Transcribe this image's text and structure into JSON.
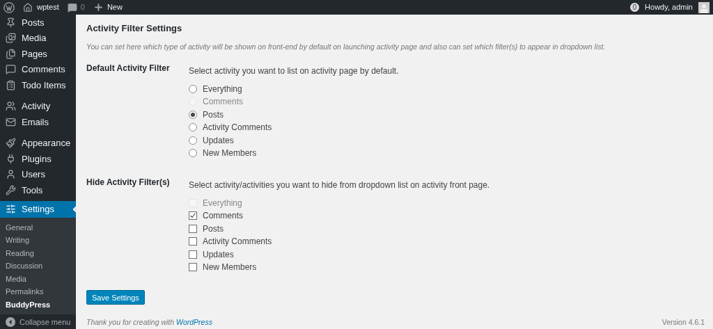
{
  "admin_bar": {
    "site": "wptest",
    "comments": "0",
    "new": "New",
    "notifications": "0",
    "greeting": "Howdy, admin"
  },
  "sidebar": {
    "groups": [
      [
        {
          "label": "Posts",
          "selected": false
        },
        {
          "label": "Media",
          "selected": false
        },
        {
          "label": "Pages",
          "selected": false
        },
        {
          "label": "Comments",
          "selected": false
        },
        {
          "label": "Todo Items",
          "selected": false
        }
      ],
      [
        {
          "label": "Activity",
          "selected": false
        },
        {
          "label": "Emails",
          "selected": false
        }
      ],
      [
        {
          "label": "Appearance",
          "selected": false
        },
        {
          "label": "Plugins",
          "selected": false
        },
        {
          "label": "Users",
          "selected": false
        },
        {
          "label": "Tools",
          "selected": false
        },
        {
          "label": "Settings",
          "selected": true
        }
      ]
    ],
    "submenu": [
      {
        "label": "General",
        "selected": false
      },
      {
        "label": "Writing",
        "selected": false
      },
      {
        "label": "Reading",
        "selected": false
      },
      {
        "label": "Discussion",
        "selected": false
      },
      {
        "label": "Media",
        "selected": false
      },
      {
        "label": "Permalinks",
        "selected": false
      },
      {
        "label": "BuddyPress",
        "selected": true
      }
    ],
    "collapse": "Collapse menu"
  },
  "page": {
    "title": "Activity Filter Settings",
    "description": "You can set here which type of activity will be shown on front-end by default on launching activity page and also can set which filter(s) to appear in dropdown list.",
    "sections": [
      {
        "label": "Default Activity Filter",
        "instruction": "Select activity you want to list on activity page by default.",
        "kind": "radio",
        "options": [
          {
            "label": "Everything",
            "selected": false,
            "disabled": false
          },
          {
            "label": "Comments",
            "selected": false,
            "disabled": true
          },
          {
            "label": "Posts",
            "selected": true,
            "disabled": false
          },
          {
            "label": "Activity Comments",
            "selected": false,
            "disabled": false
          },
          {
            "label": "Updates",
            "selected": false,
            "disabled": false
          },
          {
            "label": "New Members",
            "selected": false,
            "disabled": false
          }
        ]
      },
      {
        "label": "Hide Activity Filter(s)",
        "instruction": "Select activity/activities you want to hide from dropdown list on activity front page.",
        "kind": "checkbox",
        "options": [
          {
            "label": "Everything",
            "checked": false,
            "disabled": true
          },
          {
            "label": "Comments",
            "checked": true,
            "disabled": false
          },
          {
            "label": "Posts",
            "checked": false,
            "disabled": false
          },
          {
            "label": "Activity Comments",
            "checked": false,
            "disabled": false
          },
          {
            "label": "Updates",
            "checked": false,
            "disabled": false
          },
          {
            "label": "New Members",
            "checked": false,
            "disabled": false
          }
        ]
      }
    ],
    "button": "Save Settings"
  },
  "footer": {
    "thanks": "Thank you for creating with",
    "link": "WordPress",
    "version": "Version 4.6.1"
  }
}
